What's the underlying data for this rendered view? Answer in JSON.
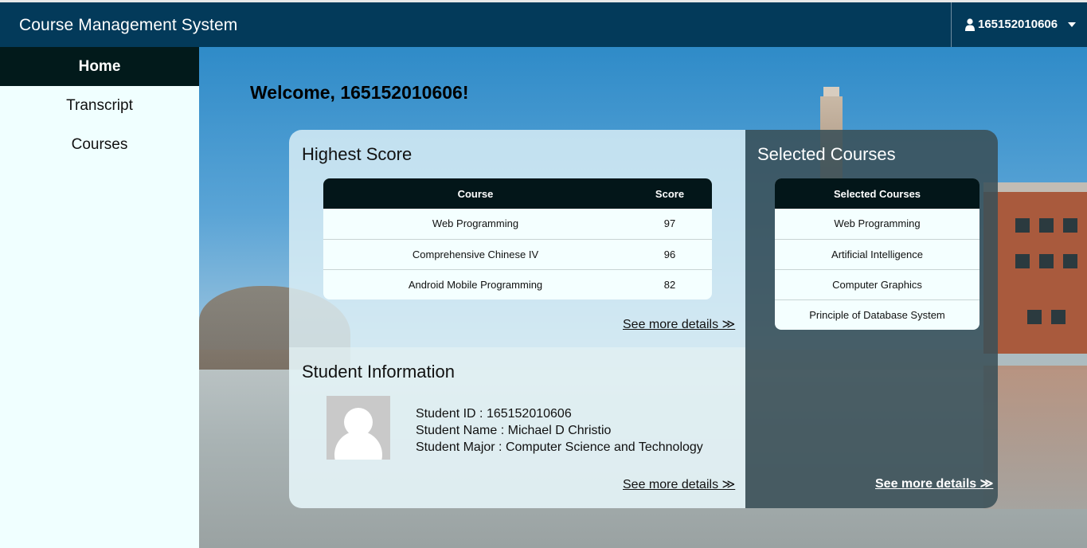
{
  "app": {
    "title": "Course Management System"
  },
  "user": {
    "id": "165152010606",
    "icon": "user-icon"
  },
  "sidebar": {
    "items": [
      {
        "label": "Home",
        "active": true
      },
      {
        "label": "Transcript",
        "active": false
      },
      {
        "label": "Courses",
        "active": false
      }
    ]
  },
  "welcome": "Welcome, 165152010606!",
  "highest_score": {
    "title": "Highest Score",
    "columns": [
      "Course",
      "Score"
    ],
    "rows": [
      [
        "Web Programming",
        "97"
      ],
      [
        "Comprehensive Chinese IV",
        "96"
      ],
      [
        "Android Mobile Programming",
        "82"
      ]
    ],
    "more": "See more details ≫"
  },
  "student_info": {
    "title": "Student Information",
    "id_line": "Student ID : 165152010606",
    "name_line": "Student Name : Michael D Christio",
    "major_line": "Student Major : Computer Science and Technology",
    "more": "See more details ≫"
  },
  "selected_courses": {
    "title": "Selected Courses",
    "column": "Selected Courses",
    "rows": [
      "Web Programming",
      "Artificial Intelligence",
      "Computer Graphics",
      "Principle of Database System"
    ],
    "more": "See more details ≫"
  },
  "colors": {
    "navbar": "#033a5a",
    "sidebar_active": "#021a1b",
    "sidebar_bg": "#f0ffff"
  }
}
